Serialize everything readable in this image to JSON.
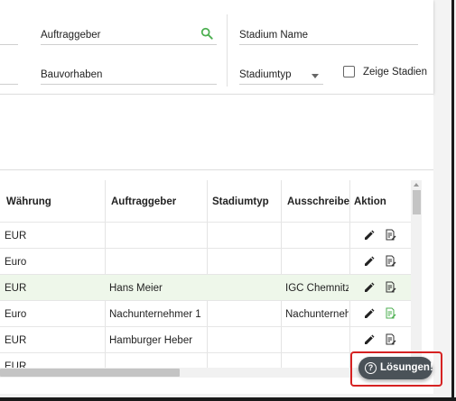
{
  "filters": {
    "auftraggeber_label": "Auftraggeber",
    "bauvorhaben_label": "Bauvorhaben",
    "stadium_name_label": "Stadium Name",
    "stadiumtyp_label": "Stadiumtyp",
    "zeige_stadien_label": "Zeige Stadien",
    "search_icon": "search-icon",
    "accent_color": "#4caf50"
  },
  "table": {
    "headers": [
      "Währung",
      "Auftraggeber",
      "Stadiumtyp",
      "Ausschreibend",
      "Aktion"
    ],
    "rows": [
      {
        "waehrung": "EUR",
        "auftraggeber": "",
        "stadiumtyp": "",
        "ausschreibend": "",
        "highlight": false
      },
      {
        "waehrung": "Euro",
        "auftraggeber": "",
        "stadiumtyp": "",
        "ausschreibend": "",
        "highlight": false
      },
      {
        "waehrung": "EUR",
        "auftraggeber": "Hans Meier",
        "stadiumtyp": "",
        "ausschreibend": "IGC Chemnitz",
        "highlight": true
      },
      {
        "waehrung": "Euro",
        "auftraggeber": "Nachunternehmer 1",
        "stadiumtyp": "",
        "ausschreibend": "Nachunternehm",
        "highlight": false
      },
      {
        "waehrung": "EUR",
        "auftraggeber": "Hamburger Heber",
        "stadiumtyp": "",
        "ausschreibend": "",
        "highlight": false
      },
      {
        "waehrung": "EUR",
        "auftraggeber": "",
        "stadiumtyp": "",
        "ausschreibend": "",
        "highlight": false
      }
    ],
    "action_icons": [
      "edit-icon",
      "document-icon"
    ]
  },
  "help": {
    "label": "Lösungen!",
    "icon": "question-circle-icon",
    "highlight_color": "#d62222"
  }
}
